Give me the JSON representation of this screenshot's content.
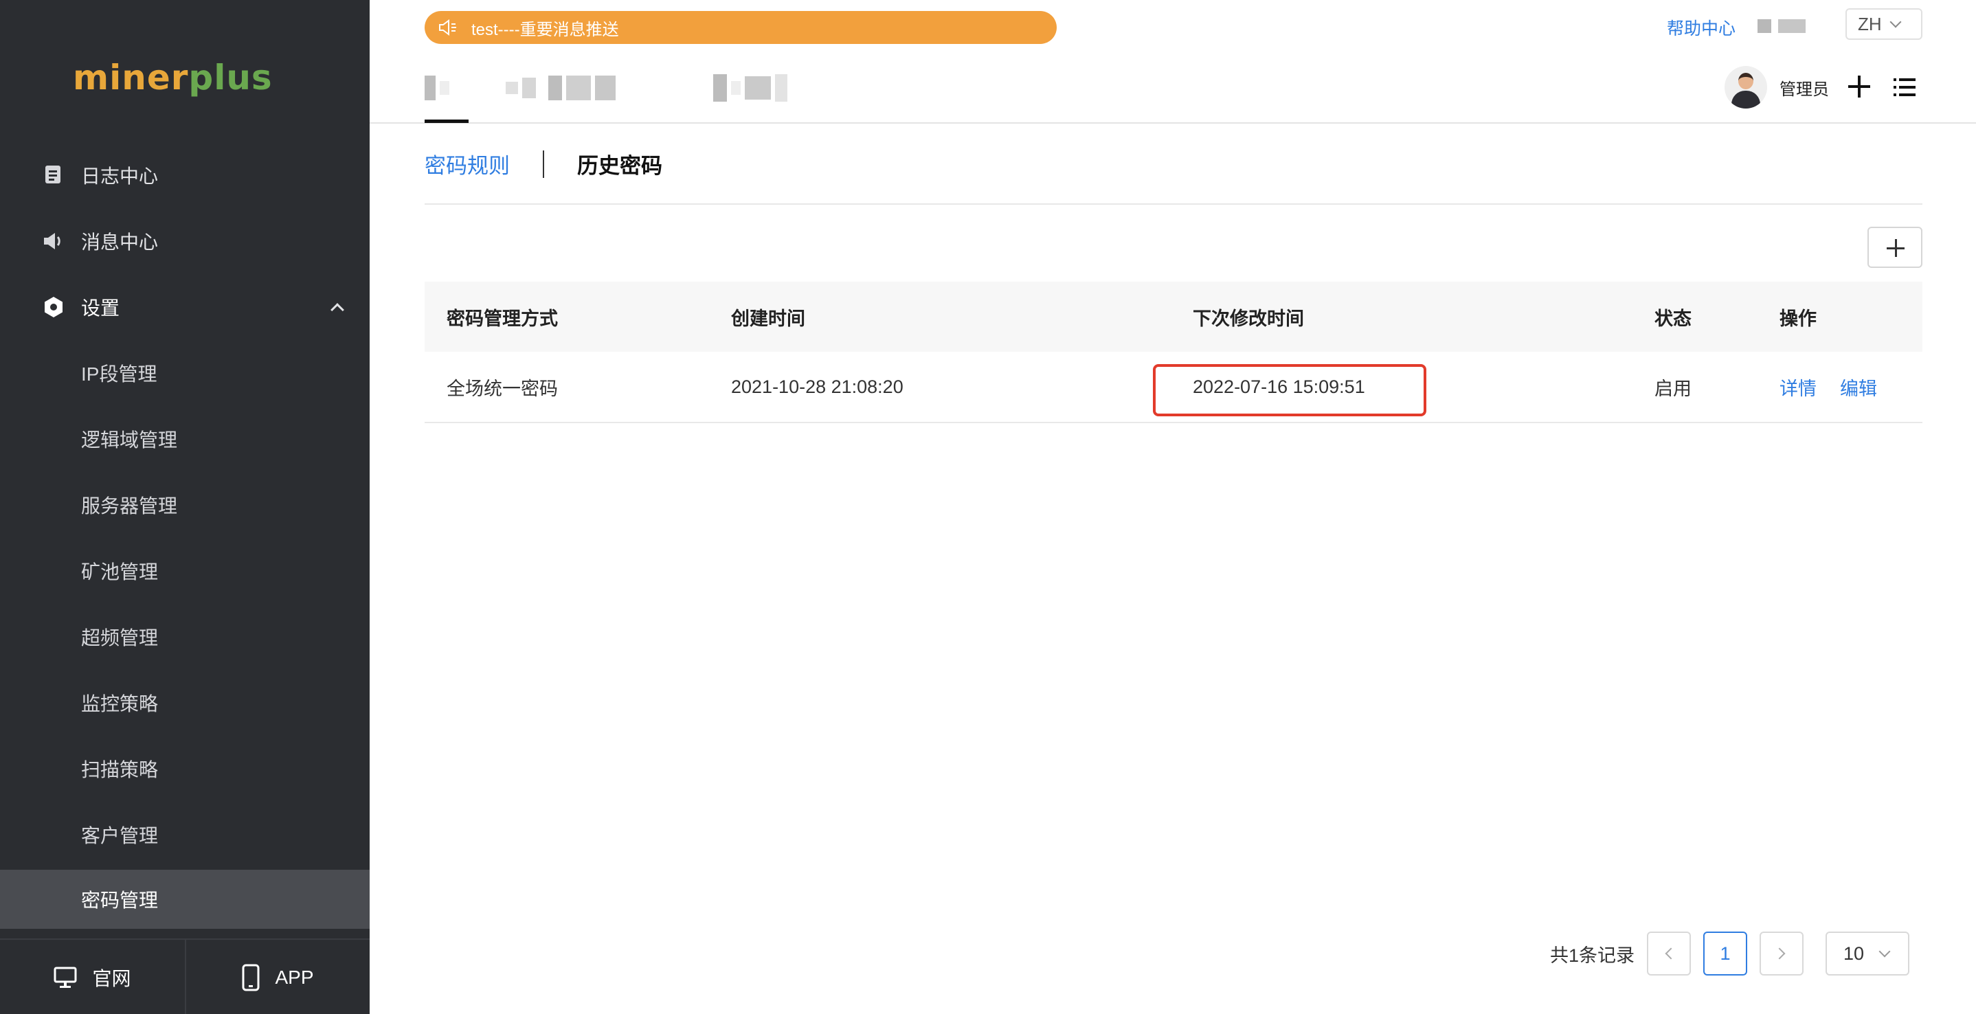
{
  "sidebar": {
    "logo": {
      "part1": "miner",
      "part2": "plus"
    },
    "items": [
      {
        "label": "日志中心",
        "icon": "log-icon"
      },
      {
        "label": "消息中心",
        "icon": "speaker-icon"
      },
      {
        "label": "设置",
        "icon": "settings-hex-icon"
      },
      {
        "label": "IP段管理"
      },
      {
        "label": "逻辑域管理"
      },
      {
        "label": "服务器管理"
      },
      {
        "label": "矿池管理"
      },
      {
        "label": "超频管理"
      },
      {
        "label": "监控策略"
      },
      {
        "label": "扫描策略"
      },
      {
        "label": "客户管理"
      },
      {
        "label": "密码管理"
      }
    ],
    "bottom": {
      "website": "官网",
      "app": "APP"
    }
  },
  "header": {
    "notice": "test----重要消息推送",
    "help": "帮助中心",
    "lang": "ZH",
    "user": "管理员"
  },
  "subtabs": {
    "active": "密码规则",
    "inactive": "历史密码"
  },
  "table": {
    "headers": [
      "密码管理方式",
      "创建时间",
      "下次修改时间",
      "状态",
      "操作"
    ],
    "rows": [
      {
        "mode": "全场统一密码",
        "created": "2021-10-28 21:08:20",
        "next": "2022-07-16 15:09:51",
        "status": "启用",
        "detail": "详情",
        "edit": "编辑"
      }
    ]
  },
  "pagination": {
    "total": "共1条记录",
    "current": "1",
    "page_size": "10"
  },
  "colors": {
    "accent": "#2f7de1",
    "notice": "#f2a03d",
    "sidebar": "#2b2d31",
    "highlight": "#e23b2b"
  }
}
